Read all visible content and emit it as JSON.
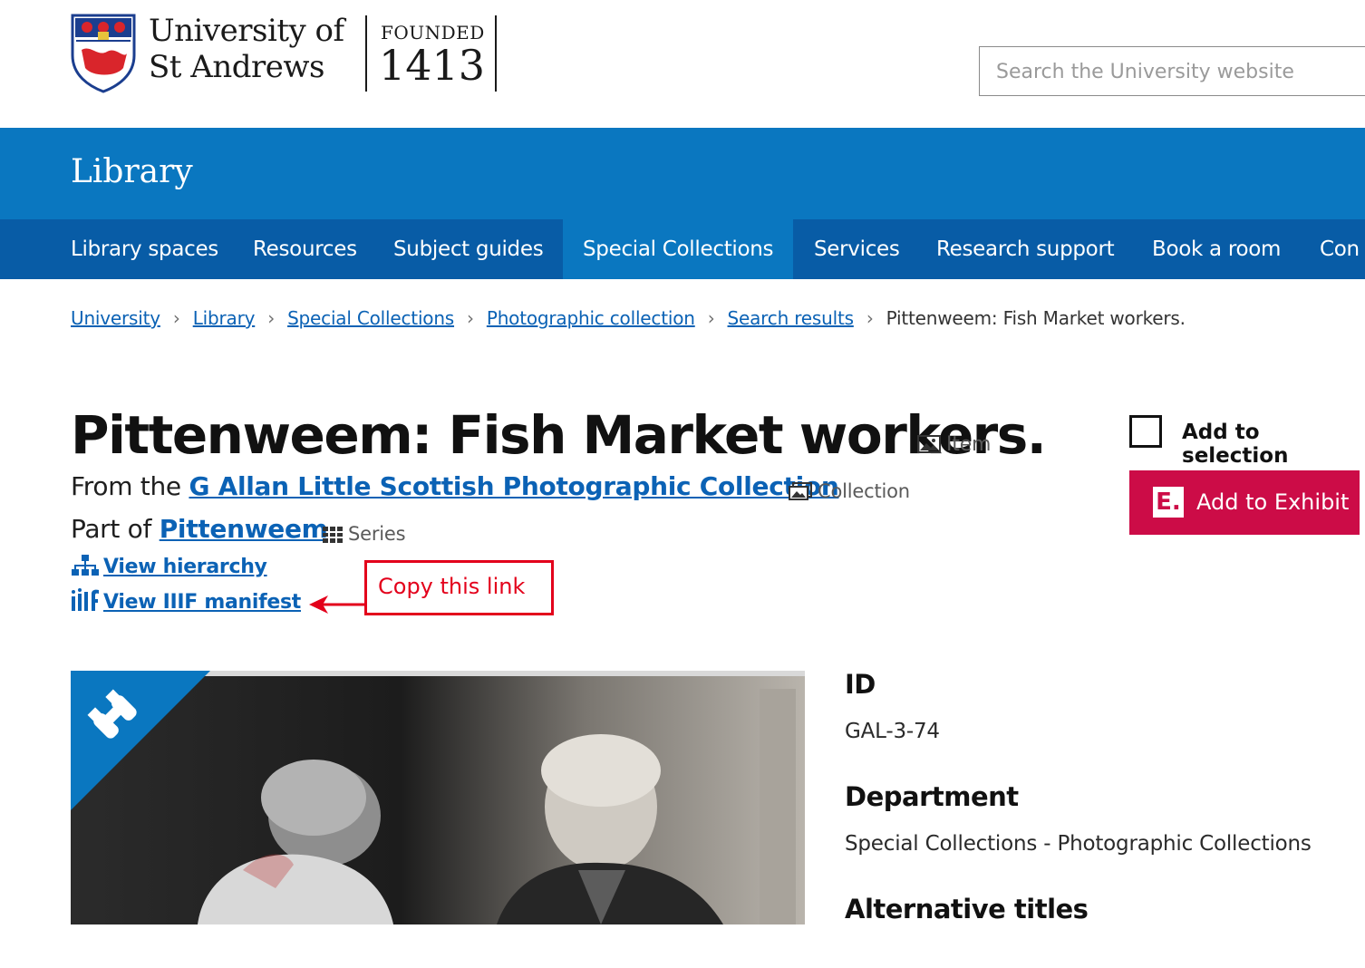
{
  "header": {
    "uni_line1": "University of",
    "uni_line2": "St Andrews",
    "founded_label": "FOUNDED",
    "founded_year": "1413",
    "search_placeholder": "Search the University website"
  },
  "banner": {
    "title": "Library"
  },
  "nav": {
    "items": [
      "Library spaces",
      "Resources",
      "Subject guides",
      "Special Collections",
      "Services",
      "Research support",
      "Book a room",
      "Con"
    ],
    "active_index": 3
  },
  "breadcrumb": {
    "links": [
      "University",
      "Library",
      "Special Collections",
      "Photographic collection",
      "Search results"
    ],
    "current": "Pittenweem: Fish Market workers."
  },
  "record": {
    "title": "Pittenweem: Fish Market workers.",
    "title_type": "Item",
    "from_prefix": "From the",
    "collection_link": "G Allan Little Scottish Photographic Collection",
    "collection_type": "Collection",
    "part_prefix": "Part of",
    "series_link": "Pittenweem",
    "series_type": "Series",
    "view_hierarchy": "View hierarchy",
    "view_iiif": "View IIIF manifest"
  },
  "annotation": {
    "callout": "Copy this link",
    "color": "#e3001b"
  },
  "actions": {
    "add_to_selection": "Add to selection",
    "add_to_exhibit": "Add to Exhibit",
    "exhibit_icon_letter": "E."
  },
  "metadata": [
    {
      "label": "ID",
      "value": "GAL-3-74"
    },
    {
      "label": "Department",
      "value": "Special Collections - Photographic Collections"
    },
    {
      "label": "Alternative titles",
      "value": ""
    }
  ],
  "colors": {
    "banner_blue": "#0a77c0",
    "nav_blue": "#085ca6",
    "link_blue": "#0b62b5",
    "exhibit_red": "#cc0c47"
  }
}
